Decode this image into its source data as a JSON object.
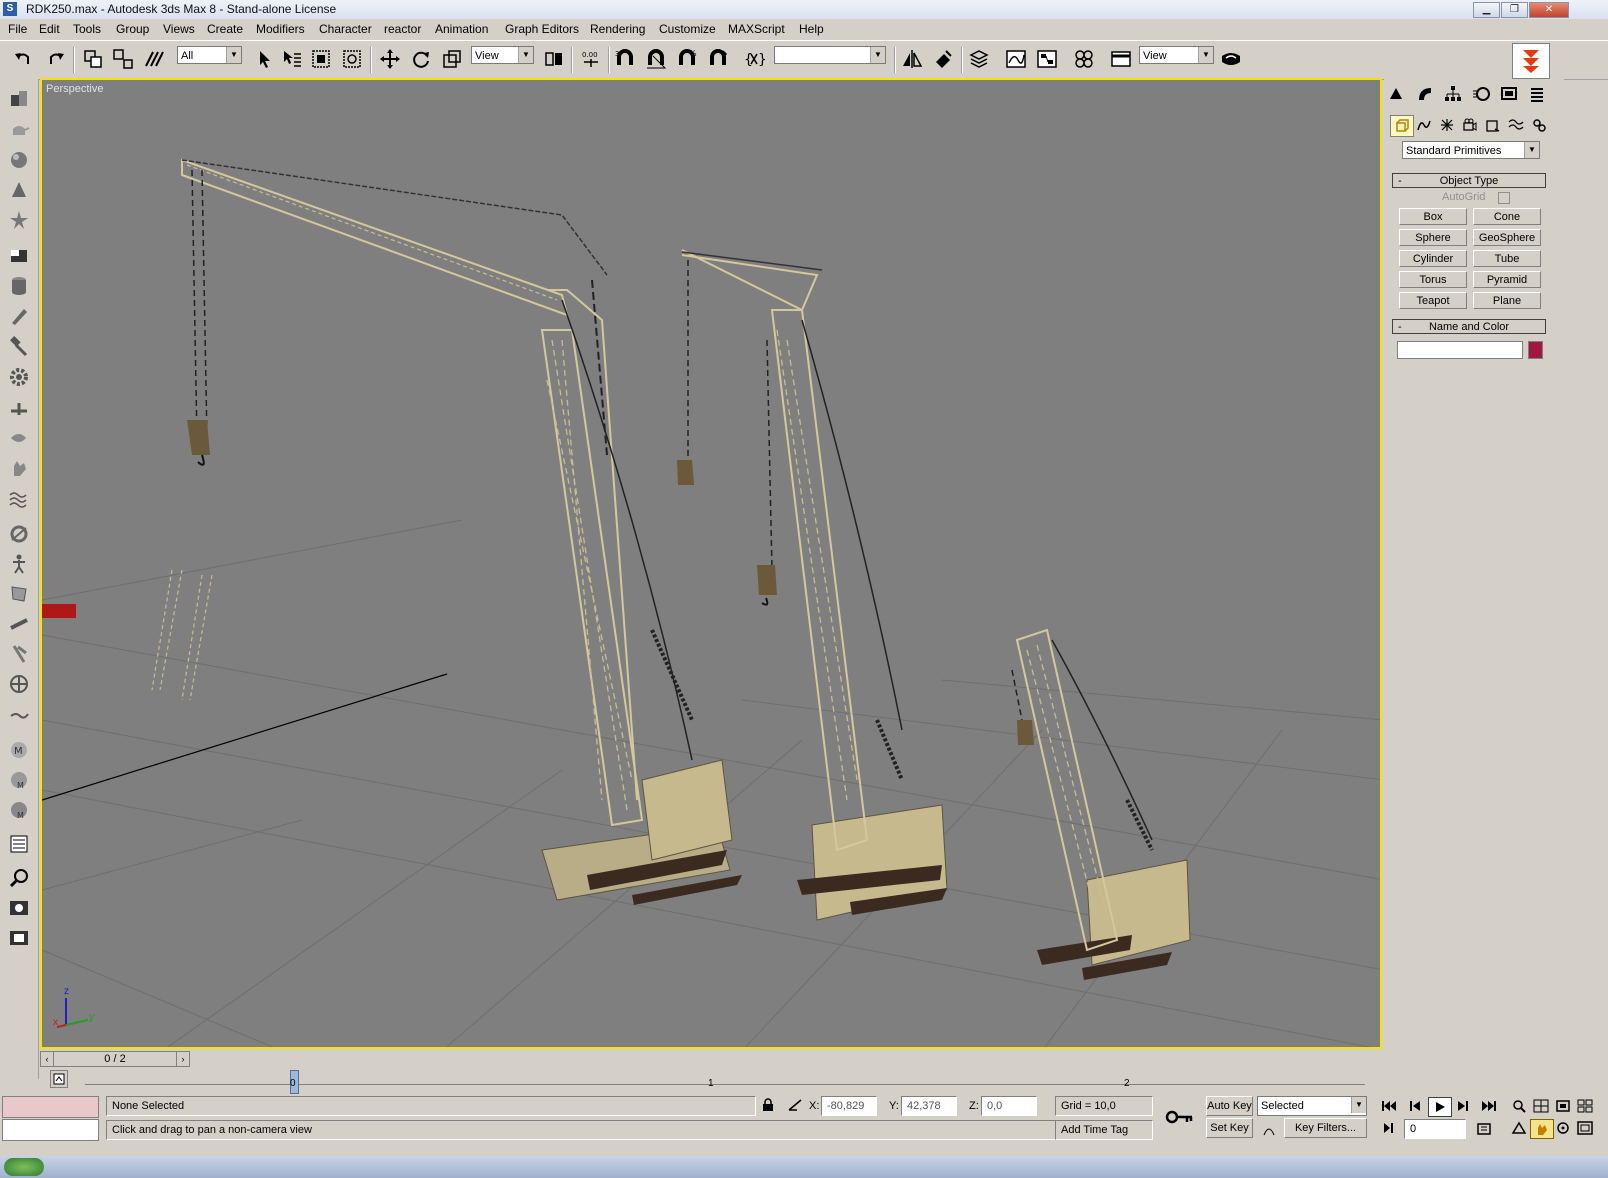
{
  "window": {
    "title": "RDK250.max - Autodesk 3ds Max 8  - Stand-alone License",
    "minimize_icon": "minimize-icon",
    "maximize_icon": "restore-icon",
    "close_icon": "close-icon"
  },
  "menu": [
    "File",
    "Edit",
    "Tools",
    "Group",
    "Views",
    "Create",
    "Modifiers",
    "Character",
    "reactor",
    "Animation",
    "Graph Editors",
    "Rendering",
    "Customize",
    "MAXScript",
    "Help"
  ],
  "toolbar": {
    "selection_filter": "All",
    "ref_coord_system": "View",
    "named_selection": "",
    "ref_coord_system_2": "View",
    "icons": [
      "undo-icon",
      "redo-icon",
      "select-and-link-icon",
      "unlink-icon",
      "bind-space-warp-icon",
      "select-object-icon",
      "select-by-name-icon",
      "rect-selection-region-icon",
      "window-crossing-icon",
      "select-move-icon",
      "select-rotate-icon",
      "select-scale-icon",
      "pivot-center-icon",
      "select-manipulate-icon",
      "snap-toggle-icon",
      "angle-snap-icon",
      "percent-snap-icon",
      "spinner-snap-icon",
      "edit-named-sets-icon",
      "mirror-icon",
      "align-icon",
      "layer-manager-icon",
      "curve-editor-icon",
      "schematic-view-icon",
      "material-editor-icon",
      "render-scene-icon",
      "quick-render-icon"
    ]
  },
  "viewport": {
    "label": "Perspective",
    "axis_x": "x",
    "axis_y": "y",
    "axis_z": "z"
  },
  "command_panel": {
    "category_dropdown": "Standard Primitives",
    "object_type_title": "Object Type",
    "autogrid_label": "AutoGrid",
    "primitives": [
      "Box",
      "Cone",
      "Sphere",
      "GeoSphere",
      "Cylinder",
      "Tube",
      "Torus",
      "Pyramid",
      "Teapot",
      "Plane"
    ],
    "name_color_title": "Name and Color",
    "object_name": "",
    "object_color": "#a01840",
    "rollout_collapse": "-"
  },
  "trackbar": {
    "frame_counter": "0 / 2",
    "ticks": [
      "0",
      "1",
      "2"
    ]
  },
  "status": {
    "selection": "None Selected",
    "prompt": "Click and drag to pan a non-camera view",
    "x_label": "X:",
    "x_value": "-80,829",
    "y_label": "Y:",
    "y_value": "42,378",
    "z_label": "Z:",
    "z_value": "0,0",
    "grid": "Grid = 10,0",
    "add_time_tag": "Add Time Tag",
    "auto_key": "Auto Key",
    "set_key": "Set Key",
    "key_mode": "Selected",
    "key_filters": "Key Filters...",
    "current_frame": "0"
  },
  "colors": {
    "viewport_bg": "#7f7f7f",
    "active_viewport_border": "#f2e600",
    "crane_lattice": "#c8bd92",
    "crane_body": "#c7b98e",
    "crane_tracks": "#3b2a20"
  }
}
